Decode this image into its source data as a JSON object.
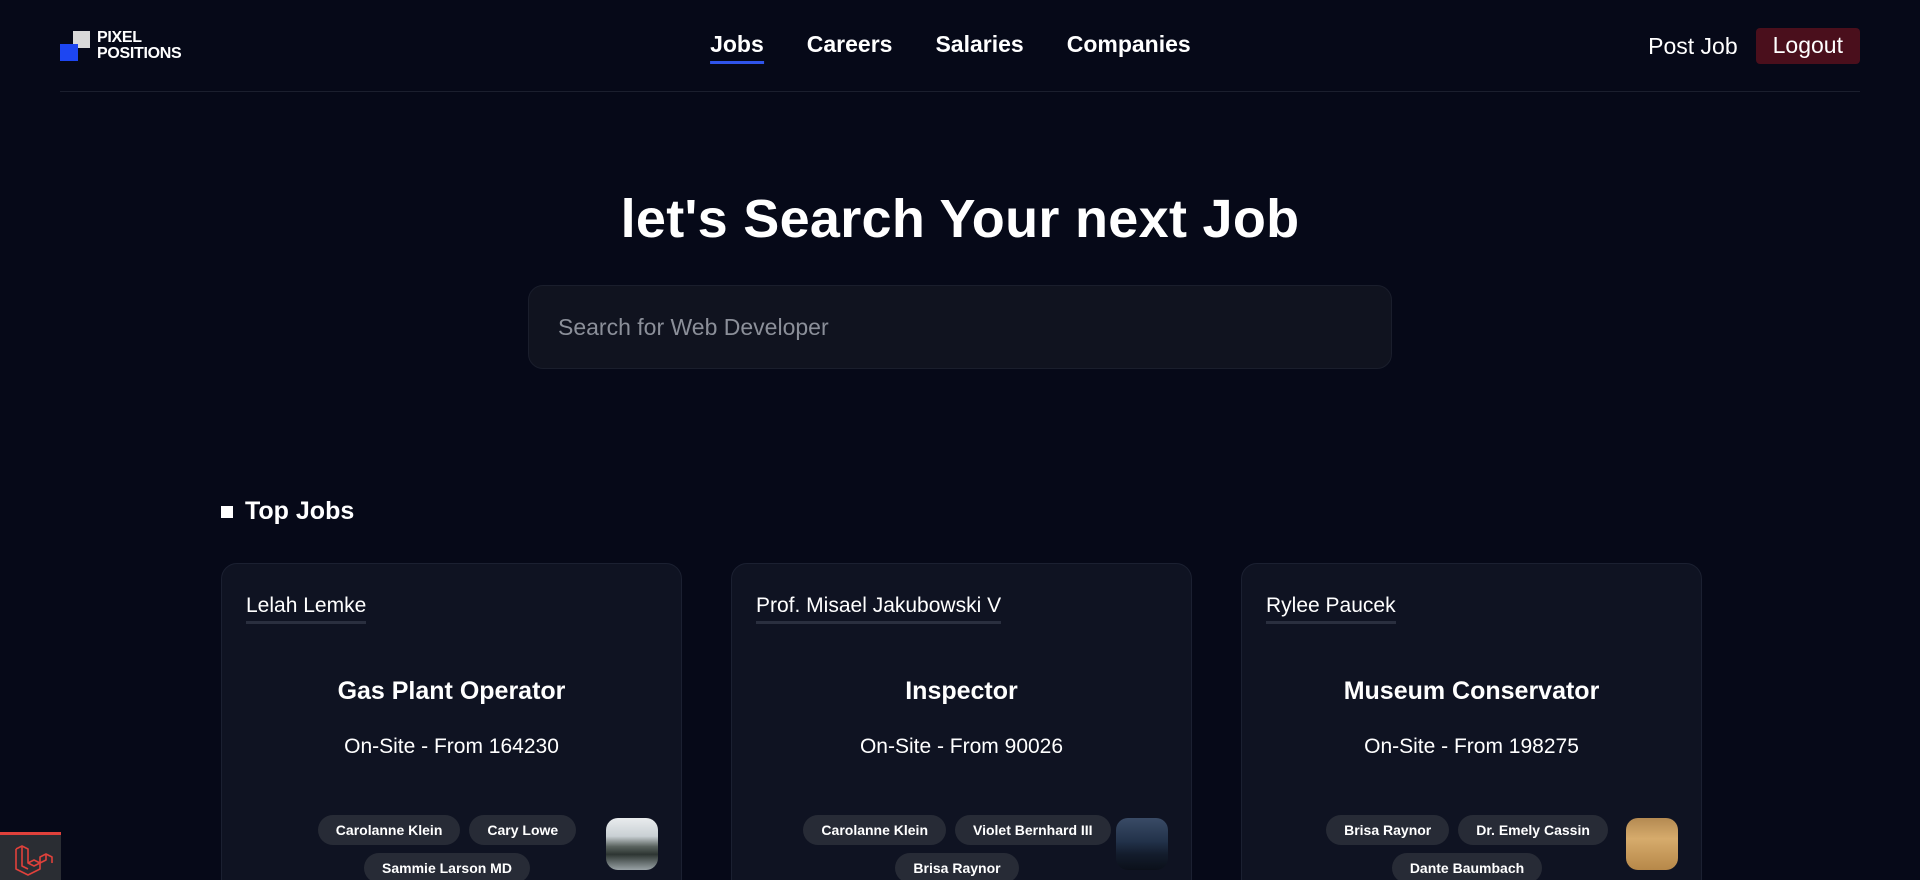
{
  "header": {
    "logo": {
      "line1": "PIXEL",
      "line2": "POSITIONS"
    },
    "nav": [
      {
        "label": "Jobs",
        "active": true
      },
      {
        "label": "Careers",
        "active": false
      },
      {
        "label": "Salaries",
        "active": false
      },
      {
        "label": "Companies",
        "active": false
      }
    ],
    "post_job": "Post Job",
    "logout": "Logout"
  },
  "hero": {
    "title": "let's Search Your next Job",
    "search_placeholder": "Search for Web Developer"
  },
  "top_jobs": {
    "heading": "Top Jobs",
    "cards": [
      {
        "employer": "Lelah Lemke",
        "title": "Gas Plant Operator",
        "meta": "On-Site - From 164230",
        "tags": [
          "Carolanne Klein",
          "Cary Lowe",
          "Sammie Larson MD"
        ],
        "thumb_icon": "mountain-landscape-thumbnail"
      },
      {
        "employer": "Prof. Misael Jakubowski V",
        "title": "Inspector",
        "meta": "On-Site - From 90026",
        "tags": [
          "Carolanne Klein",
          "Violet Bernhard III",
          "Brisa Raynor"
        ],
        "thumb_icon": "dusk-landscape-thumbnail"
      },
      {
        "employer": "Rylee Paucek",
        "title": "Museum Conservator",
        "meta": "On-Site - From 198275",
        "tags": [
          "Brisa Raynor",
          "Dr. Emely Cassin",
          "Dante Baumbach"
        ],
        "thumb_icon": "laptop-desk-thumbnail"
      }
    ]
  },
  "colors": {
    "background": "#060918",
    "card": "#0f1322",
    "accent": "#2f54eb",
    "logout_bg": "#4a0f1c",
    "tag_bg": "#272b36"
  }
}
